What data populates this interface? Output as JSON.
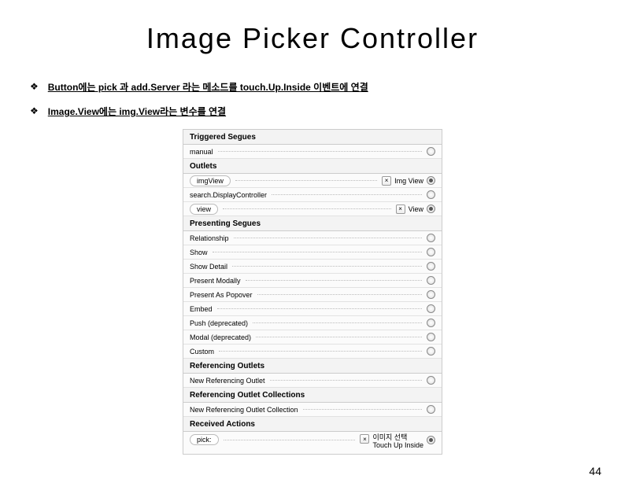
{
  "title": "Image Picker Controller",
  "bullets": [
    "Button에는 pick 과 add.Server 라는 메소드를 touch.Up.Inside 이벤트에 연결",
    "Image.View에는 img.View라는 변수를 연결"
  ],
  "panel": {
    "triggered_segues": {
      "header": "Triggered Segues",
      "manual": "manual"
    },
    "outlets": {
      "header": "Outlets",
      "imgView": {
        "left": "imgView",
        "right": "Img View"
      },
      "searchDisplay": "search.DisplayController",
      "view": {
        "left": "view",
        "right": "View"
      }
    },
    "presenting": {
      "header": "Presenting Segues",
      "items": [
        "Relationship",
        "Show",
        "Show Detail",
        "Present Modally",
        "Present As Popover",
        "Embed",
        "Push (deprecated)",
        "Modal (deprecated)",
        "Custom"
      ]
    },
    "ref_outlets": {
      "header": "Referencing Outlets",
      "item": "New Referencing Outlet"
    },
    "ref_collections": {
      "header": "Referencing Outlet Collections",
      "item": "New Referencing Outlet Collection"
    },
    "received": {
      "header": "Received Actions",
      "pick": "pick:",
      "target1": "이미지 선택",
      "target2": "Touch Up Inside"
    }
  },
  "page_number": "44"
}
